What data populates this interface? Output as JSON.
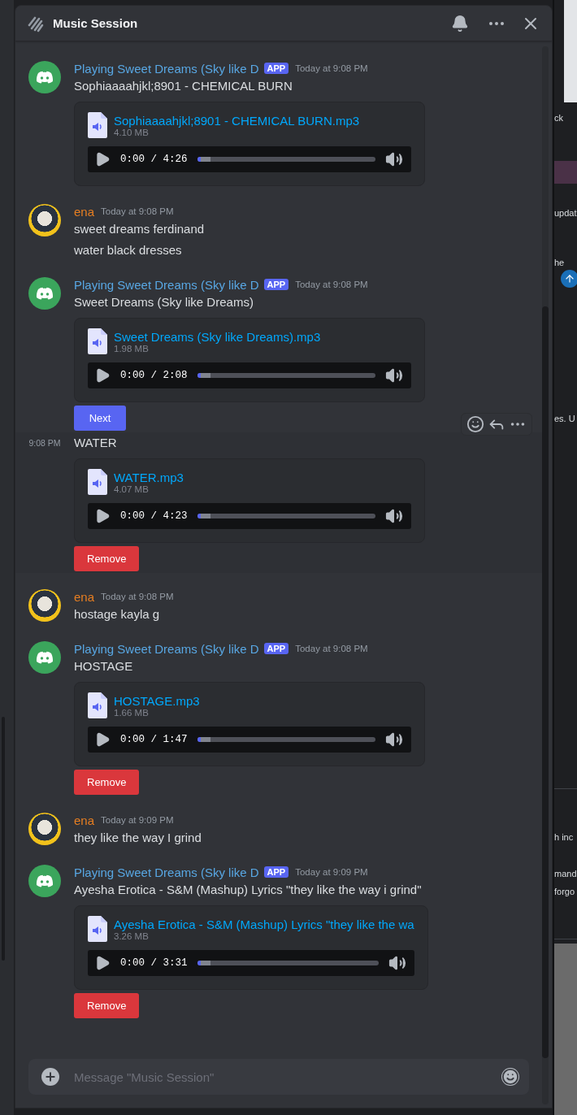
{
  "window": {
    "title": "Music Session"
  },
  "messages": [
    {
      "kind": "bot",
      "author": "Playing Sweet Dreams (Sky like D",
      "badge": "APP",
      "time": "Today at 9:08 PM",
      "text": "Sophiaaaahjkl;8901 - CHEMICAL BURN",
      "hovered": false,
      "attachment": {
        "filename": "Sophiaaaahjkl;8901 - CHEMICAL BURN.mp3",
        "size": "4.10 MB",
        "playback": "0:00 / 4:26",
        "level": 0.02
      }
    },
    {
      "kind": "user",
      "author": "ena",
      "time": "Today at 9:08 PM",
      "text": "sweet dreams ferdinand",
      "hovered": false
    },
    {
      "kind": "continuation",
      "text": "water black dresses",
      "hovered": false
    },
    {
      "kind": "bot",
      "author": "Playing Sweet Dreams (Sky like D",
      "badge": "APP",
      "time": "Today at 9:08 PM",
      "text": "Sweet Dreams (Sky like Dreams)",
      "hovered": false,
      "attachment": {
        "filename": "Sweet Dreams (Sky like Dreams).mp3",
        "size": "1.98 MB",
        "playback": "0:00 / 2:08",
        "level": 0.02
      },
      "button": {
        "kind": "primary",
        "label": "Next"
      }
    },
    {
      "kind": "continuation",
      "hover_time": "9:08 PM",
      "text": "WATER",
      "hovered": true,
      "attachment": {
        "filename": "WATER.mp3",
        "size": "4.07 MB",
        "playback": "0:00 / 4:23",
        "level": 0.02
      },
      "button": {
        "kind": "danger",
        "label": "Remove"
      }
    },
    {
      "kind": "user",
      "author": "ena",
      "time": "Today at 9:08 PM",
      "text": "hostage kayla g",
      "hovered": false
    },
    {
      "kind": "bot",
      "author": "Playing Sweet Dreams (Sky like D",
      "badge": "APP",
      "time": "Today at 9:08 PM",
      "text": "HOSTAGE",
      "hovered": false,
      "attachment": {
        "filename": "HOSTAGE.mp3",
        "size": "1.66 MB",
        "playback": "0:00 / 1:47",
        "level": 0.02
      },
      "button": {
        "kind": "danger",
        "label": "Remove"
      }
    },
    {
      "kind": "user",
      "author": "ena",
      "time": "Today at 9:09 PM",
      "text": "they like the way I grind",
      "hovered": false
    },
    {
      "kind": "bot",
      "author": "Playing Sweet Dreams (Sky like D",
      "badge": "APP",
      "time": "Today at 9:09 PM",
      "text": "Ayesha Erotica - S&M (Mashup) Lyrics \"they like the way i grind\"",
      "hovered": false,
      "attachment": {
        "filename": "Ayesha Erotica - S&M (Mashup) Lyrics \"they like the wa",
        "size": "3.26 MB",
        "playback": "0:00 / 3:31",
        "level": 0.02
      },
      "button": {
        "kind": "danger",
        "label": "Remove"
      }
    }
  ],
  "composer": {
    "placeholder": "Message \"Music Session\""
  },
  "background_app": {
    "snippets": [
      "ck",
      "updat",
      "he",
      "es. U",
      "h inc",
      "mand",
      "forgo"
    ]
  }
}
